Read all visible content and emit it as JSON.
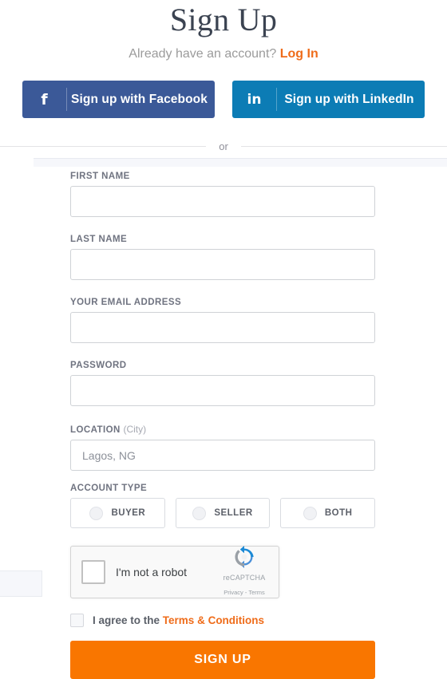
{
  "header": {
    "title": "Sign Up",
    "subtitle_prefix": "Already have an account?",
    "login_label": "Log In"
  },
  "social": {
    "facebook": {
      "label": "Sign up with Facebook",
      "icon": "facebook-f-icon",
      "glyph": "f",
      "color": "#3b5998"
    },
    "linkedin": {
      "label": "Sign up with LinkedIn",
      "icon": "linkedin-in-icon",
      "glyph": "in",
      "color": "#0c7cb5"
    }
  },
  "divider": {
    "text": "or"
  },
  "form": {
    "first_name": {
      "label": "FIRST NAME",
      "value": "",
      "placeholder": ""
    },
    "last_name": {
      "label": "LAST NAME",
      "value": "",
      "placeholder": ""
    },
    "email": {
      "label": "YOUR EMAIL ADDRESS",
      "value": "",
      "placeholder": ""
    },
    "password": {
      "label": "PASSWORD",
      "value": "",
      "placeholder": ""
    },
    "location": {
      "label": "LOCATION",
      "label_sub": "(City)",
      "value": "",
      "placeholder": "Lagos, NG"
    },
    "account_type": {
      "label": "ACCOUNT TYPE",
      "options": [
        {
          "label": "BUYER",
          "selected": false
        },
        {
          "label": "SELLER",
          "selected": false
        },
        {
          "label": "BOTH",
          "selected": false
        }
      ]
    }
  },
  "recaptcha": {
    "text": "I'm not a robot",
    "brand": "reCAPTCHA",
    "legal": "Privacy - Terms",
    "checked": false
  },
  "terms": {
    "text": "I agree to the",
    "link_label": "Terms & Conditions",
    "checked": false
  },
  "submit": {
    "label": "SIGN UP",
    "color": "#f97600"
  },
  "colors": {
    "accent_orange": "#ef6c1a",
    "button_orange": "#f97600",
    "facebook_blue": "#3b5998",
    "linkedin_blue": "#0c7cb5",
    "label_gray": "#6f7380",
    "title_ink": "#3b4351"
  }
}
